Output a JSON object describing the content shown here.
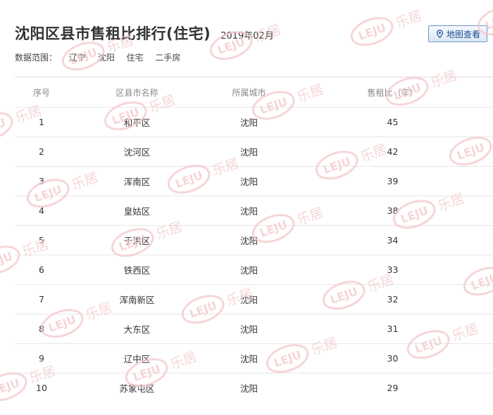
{
  "header": {
    "title": "沈阳区县市售租比排行(住宅)",
    "date": "2019年02月",
    "scope_label": "数据范围：",
    "scope_items": [
      "辽宁",
      "沈阳",
      "住宅",
      "二手房"
    ],
    "map_button_label": "地图查看"
  },
  "table": {
    "columns": [
      "序号",
      "区县市名称",
      "所属城市",
      "售租比（年）"
    ],
    "rows": [
      {
        "rank": "1",
        "district": "和平区",
        "city": "沈阳",
        "ratio": "45"
      },
      {
        "rank": "2",
        "district": "沈河区",
        "city": "沈阳",
        "ratio": "42"
      },
      {
        "rank": "3",
        "district": "浑南区",
        "city": "沈阳",
        "ratio": "39"
      },
      {
        "rank": "4",
        "district": "皇姑区",
        "city": "沈阳",
        "ratio": "38"
      },
      {
        "rank": "5",
        "district": "于洪区",
        "city": "沈阳",
        "ratio": "34"
      },
      {
        "rank": "6",
        "district": "铁西区",
        "city": "沈阳",
        "ratio": "33"
      },
      {
        "rank": "7",
        "district": "浑南新区",
        "city": "沈阳",
        "ratio": "32"
      },
      {
        "rank": "8",
        "district": "大东区",
        "city": "沈阳",
        "ratio": "31"
      },
      {
        "rank": "9",
        "district": "辽中区",
        "city": "沈阳",
        "ratio": "30"
      },
      {
        "rank": "10",
        "district": "苏家屯区",
        "city": "沈阳",
        "ratio": "29"
      }
    ]
  },
  "watermark": {
    "logo_text": "LEJU",
    "brand_text": "乐居",
    "color": "#f3c9cc"
  },
  "colors": {
    "button_border": "#6f96c6",
    "button_text": "#1d4f8f",
    "row_border": "#e8e8e8",
    "header_text": "#888888"
  },
  "icons": {
    "map_button": "map-pin-icon"
  }
}
